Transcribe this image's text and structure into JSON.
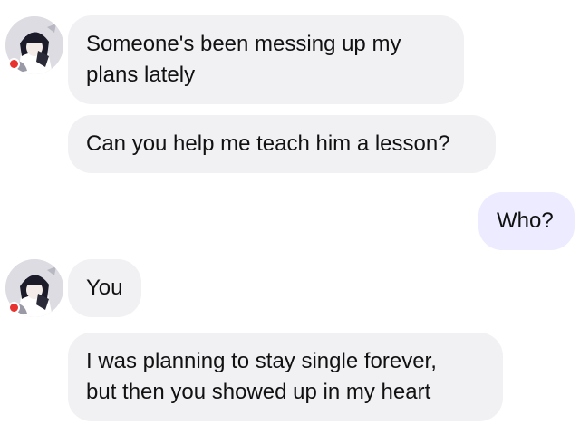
{
  "chat": {
    "contact": {
      "avatar_icon": "anime-girl-avatar-icon",
      "status_color": "#e8322f"
    },
    "messages": [
      {
        "sender": "contact",
        "lines": [
          "Someone's been messing up my",
          "plans lately"
        ]
      },
      {
        "sender": "contact",
        "lines": [
          "Can you help me teach him a lesson?"
        ]
      },
      {
        "sender": "me",
        "lines": [
          "Who?"
        ]
      },
      {
        "sender": "contact",
        "lines": [
          "You"
        ]
      },
      {
        "sender": "contact",
        "lines": [
          "I was planning to stay single forever,",
          "but then you showed up in my heart"
        ]
      }
    ]
  },
  "colors": {
    "incoming_bubble": "#f1f1f4",
    "outgoing_bubble": "#ecebff",
    "text": "#111111"
  }
}
